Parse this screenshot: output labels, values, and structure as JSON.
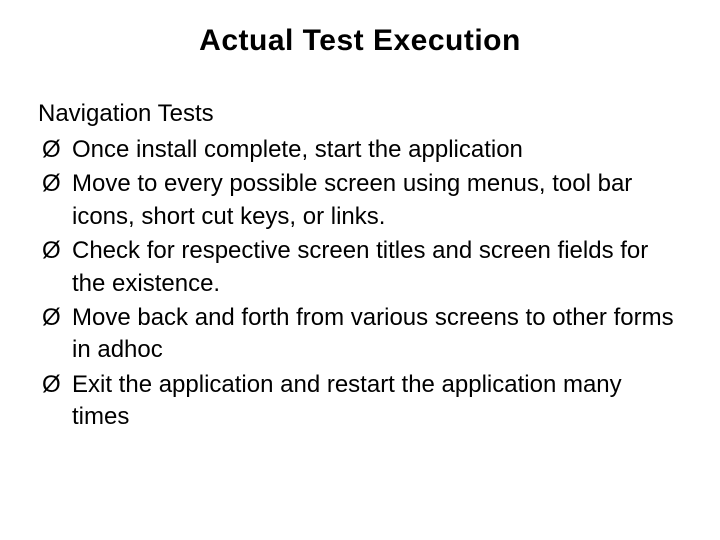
{
  "title": "Actual  Test  Execution",
  "subtitle": "Navigation  Tests",
  "bullets": [
    "Once  install  complete,  start  the  application",
    "Move  to  every  possible  screen  using  menus,  tool  bar  icons,  short cut  keys,  or  links.",
    "Check for respective screen titles and screen fields for the existence.",
    "Move back and forth from various screens to other forms in adhoc",
    "Exit  the  application  and  restart  the  application many  times"
  ],
  "bullet_marker": "Ø"
}
